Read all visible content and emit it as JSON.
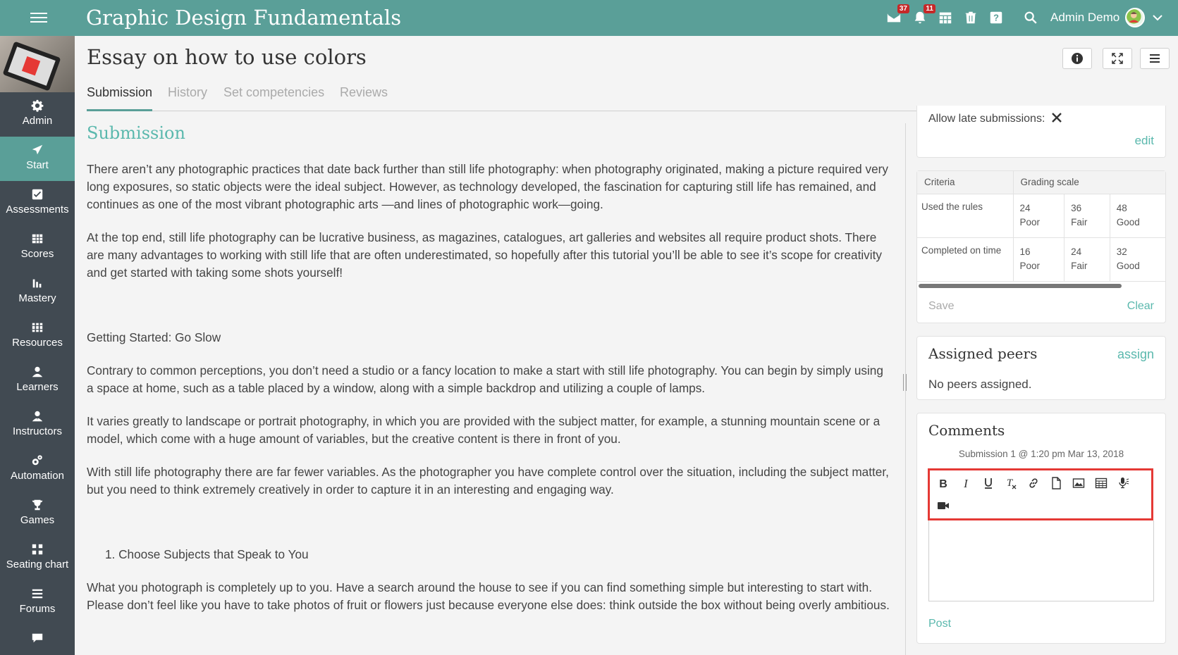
{
  "app": {
    "title": "Graphic Design Fundamentals"
  },
  "topbar": {
    "messages_badge": "37",
    "notifications_badge": "11",
    "user_name": "Admin Demo"
  },
  "sidebar": {
    "items": [
      {
        "label": "Admin",
        "icon": "gear-icon"
      },
      {
        "label": "Start",
        "icon": "paper-plane-icon"
      },
      {
        "label": "Assessments",
        "icon": "checkbox-icon"
      },
      {
        "label": "Scores",
        "icon": "table-icon"
      },
      {
        "label": "Mastery",
        "icon": "bar-chart-icon"
      },
      {
        "label": "Resources",
        "icon": "books-icon"
      },
      {
        "label": "Learners",
        "icon": "user-icon"
      },
      {
        "label": "Instructors",
        "icon": "instructor-icon"
      },
      {
        "label": "Automation",
        "icon": "cogs-icon"
      },
      {
        "label": "Games",
        "icon": "trophy-icon"
      },
      {
        "label": "Seating chart",
        "icon": "seating-icon"
      },
      {
        "label": "Forums",
        "icon": "list-icon"
      }
    ],
    "active_label": "Start",
    "accent": "#5a9f98"
  },
  "page": {
    "title": "Essay on how to use colors",
    "tabs": [
      "Submission",
      "History",
      "Set competencies",
      "Reviews"
    ],
    "active_tab": "Submission"
  },
  "submission": {
    "heading": "Submission",
    "paragraphs": [
      "There aren’t any photographic practices that date back further than still life photography: when photography originated, making a picture required very long exposures, so static objects were the ideal subject. However, as technology developed, the fascination for capturing still life has remained, and continues as one of the most vibrant photographic arts —and lines of photographic work—going.",
      "At the top end, still life photography can be lucrative business, as magazines, catalogues, art galleries and websites all require product shots. There are many advantages to working with still life that are often underestimated, so hopefully after this tutorial you’ll be able to see it’s scope for creativity and get started with taking some shots yourself!",
      "Getting Started: Go Slow",
      "Contrary to common perceptions, you don’t need a studio or a fancy location to make a start with still life photography. You can begin by simply using a space at home, such as a table placed by a window, along with a simple backdrop and utilizing a couple of lamps.",
      "It varies greatly to landscape or portrait photography, in which you are provided with the subject matter, for example, a stunning mountain scene or a model, which come with a huge amount of variables, but the creative content is there in front of you.",
      "With still life photography there are far fewer variables. As the photographer you have complete control over the situation, including the subject matter, but you need to think extremely creatively in order to capture it in an interesting and engaging way.",
      "1. Choose Subjects that Speak to You",
      "What you photograph is completely up to you. Have a search around the house to see if you can find something simple but interesting to start with. Please don’t feel like you have to take photos of fruit or flowers just because everyone else does: think outside the box without being overly ambitious."
    ]
  },
  "settings": {
    "late_label": "Allow late submissions:",
    "late_value_icon": "x-icon",
    "edit_label": "edit"
  },
  "rubric": {
    "headers": [
      "Criteria",
      "Grading scale"
    ],
    "rows": [
      {
        "criterion": "Used the rules",
        "levels": [
          {
            "points": "24",
            "label": "Poor"
          },
          {
            "points": "36",
            "label": "Fair"
          },
          {
            "points": "48",
            "label": "Good"
          }
        ]
      },
      {
        "criterion": "Completed on time",
        "levels": [
          {
            "points": "16",
            "label": "Poor"
          },
          {
            "points": "24",
            "label": "Fair"
          },
          {
            "points": "32",
            "label": "Good"
          }
        ]
      }
    ],
    "save_label": "Save",
    "clear_label": "Clear"
  },
  "peers": {
    "title": "Assigned peers",
    "assign_label": "assign",
    "empty_text": "No peers assigned."
  },
  "comments": {
    "title": "Comments",
    "subtitle": "Submission 1 @ 1:20 pm Mar 13, 2018",
    "toolbar": [
      "bold-icon",
      "italic-icon",
      "underline-icon",
      "clear-format-icon",
      "link-icon",
      "file-icon",
      "image-icon",
      "table-icon",
      "microphone-icon",
      "video-camera-icon"
    ],
    "post_label": "Post",
    "highlight_color": "#e53935"
  }
}
